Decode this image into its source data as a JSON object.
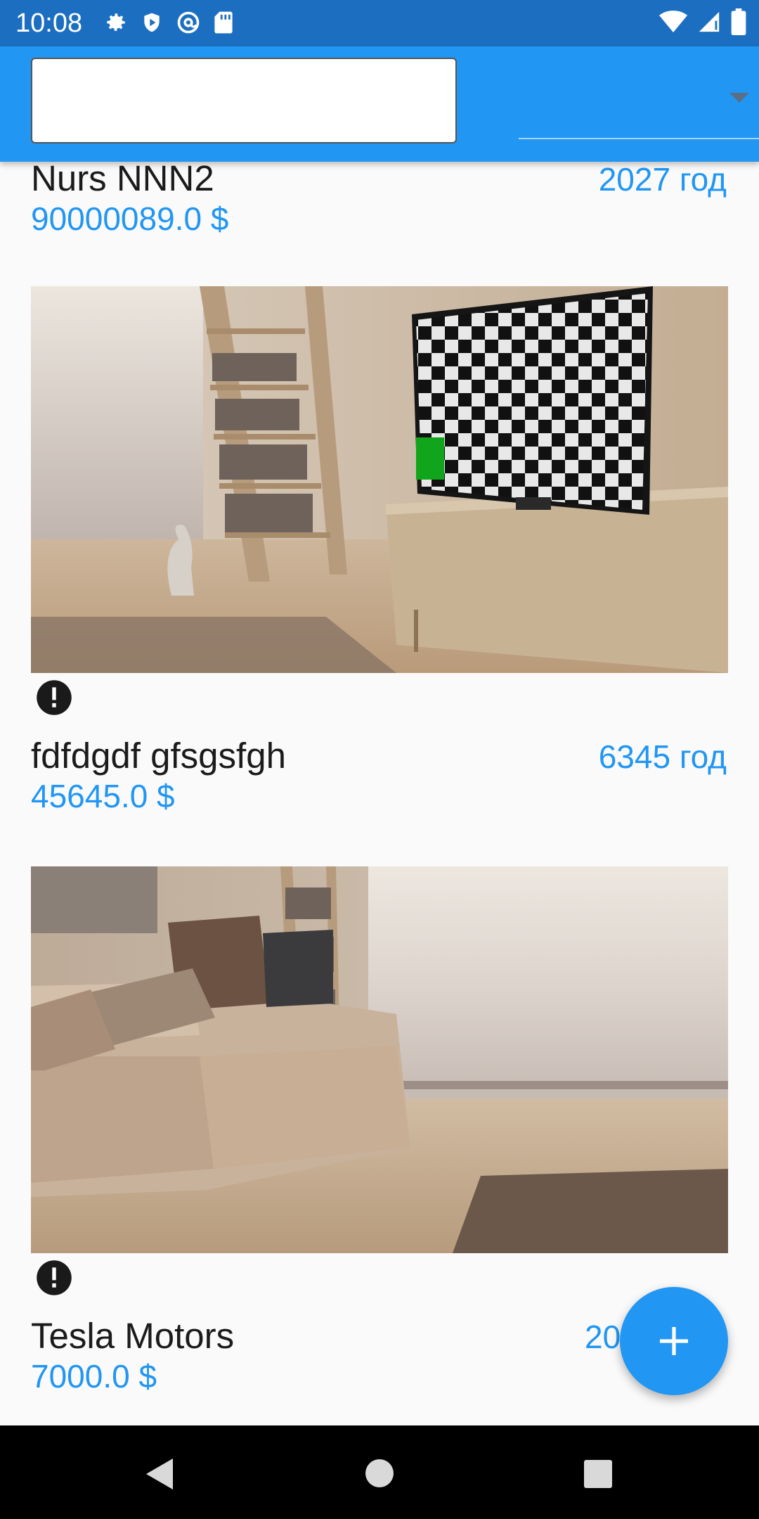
{
  "status_bar": {
    "time": "10:08",
    "left_icons": [
      "gear-icon",
      "shield-icon",
      "at-sync-icon",
      "sd-card-icon"
    ],
    "right_icons": [
      "wifi-icon",
      "signal-icon",
      "battery-icon"
    ]
  },
  "app_bar": {
    "search_value": "",
    "dropdown_value": ""
  },
  "items": [
    {
      "title": "Nurs NNN2",
      "year": "2027 год",
      "price": "90000089.0 $"
    },
    {
      "title": "fdfdgdf gfsgsfgh",
      "year": "6345 год",
      "price": "45645.0 $",
      "image": "living-room-tv-photo",
      "badge_icon": "alert-circle-icon"
    },
    {
      "title": "Tesla Motors",
      "year": "20",
      "price": "7000.0 $",
      "image": "living-room-sofa-photo",
      "badge_icon": "alert-circle-icon"
    }
  ],
  "fab": {
    "icon": "plus-icon"
  },
  "nav_bar": {
    "icons": [
      "back-icon",
      "home-icon",
      "recents-icon"
    ]
  },
  "colors": {
    "status_bar": "#1c6fc0",
    "app_bar": "#2196f3",
    "accent_text": "#2196f3",
    "background": "#fafafa"
  }
}
